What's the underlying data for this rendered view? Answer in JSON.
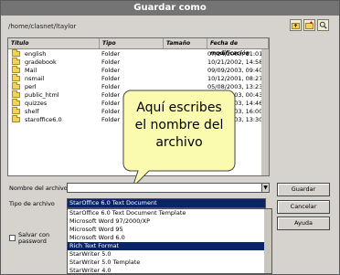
{
  "window": {
    "title": "Guardar como"
  },
  "path": "/home/clasnet/ltaylor",
  "toolbar": {
    "icons": [
      "folder-up-icon",
      "new-folder-icon",
      "search-icon"
    ]
  },
  "columns": [
    "Título",
    "Tipo",
    "Tamaño",
    "Fecha de modificación"
  ],
  "files": [
    {
      "name": "english",
      "type": "Folder",
      "size": "",
      "date": "07/24/2003, 11:01:28"
    },
    {
      "name": "gradebook",
      "type": "Folder",
      "size": "",
      "date": "10/21/2002, 14:58:56"
    },
    {
      "name": "Mail",
      "type": "Folder",
      "size": "",
      "date": "09/09/2003, 09:40:30"
    },
    {
      "name": "nsmail",
      "type": "Folder",
      "size": "",
      "date": "10/12/2001, 08:27:12"
    },
    {
      "name": "perl",
      "type": "Folder",
      "size": "",
      "date": "05/08/2003, 13:23:13"
    },
    {
      "name": "public_html",
      "type": "Folder",
      "size": "",
      "date": "10/25/2003, 00:43:00"
    },
    {
      "name": "quizzes",
      "type": "Folder",
      "size": "",
      "date": "10/22/2003, 14:46:34"
    },
    {
      "name": "shelf",
      "type": "Folder",
      "size": "",
      "date": "10/21/2003, 16:00:29"
    },
    {
      "name": "staroffice6.0",
      "type": "Folder",
      "size": "",
      "date": "07/15/2003, 13:30:54"
    }
  ],
  "tooltip": {
    "text": "Aquí escribes el nombre del archivo"
  },
  "form": {
    "filename_label": "Nombre del archivo",
    "filename_value": "",
    "filetype_label": "Tipo de archivo",
    "filetype_selected": "StarOffice 6.0 Text Document",
    "filetype_options": [
      "StarOffice 6.0 Text Document Template",
      "Microsoft Word 97/2000/XP",
      "Microsoft Word 95",
      "Microsoft Word 6.0",
      "Rich Text Format",
      "StarWriter 5.0",
      "StarWriter 5.0 Template",
      "StarWriter 4.0"
    ],
    "highlighted_option_index": 4,
    "password_label": "Salvar con password",
    "password_checked": false
  },
  "buttons": {
    "save": "Guardar",
    "cancel": "Cancelar",
    "help": "Ayuda"
  }
}
